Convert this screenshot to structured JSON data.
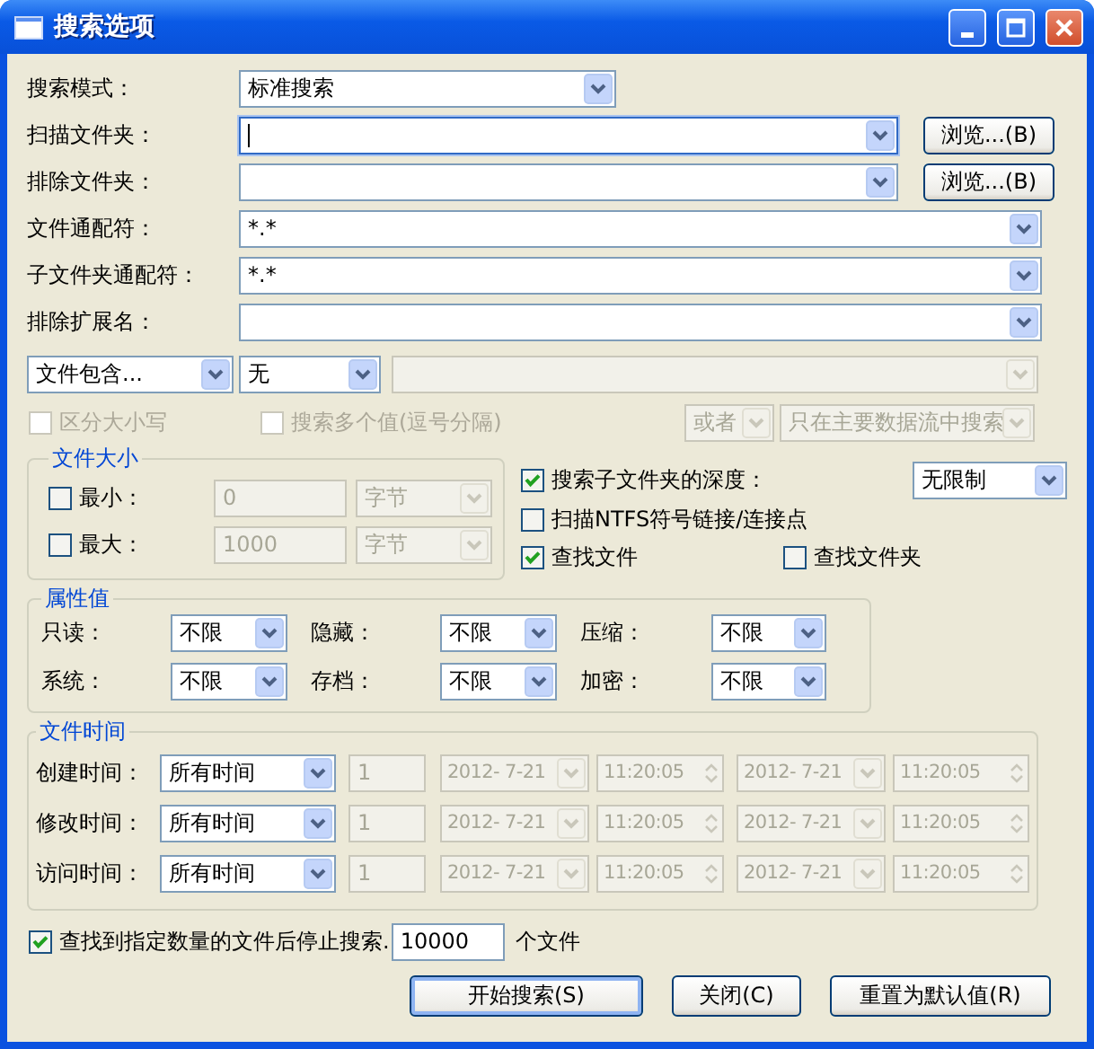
{
  "window": {
    "title": "搜索选项"
  },
  "fields": [
    {
      "label": "搜索模式：",
      "value": "标准搜索",
      "kind": "short",
      "focused": false
    },
    {
      "label": "扫描文件夹：",
      "kind": "browse",
      "focused": true,
      "button": "浏览...(B)"
    },
    {
      "label": "排除文件夹：",
      "kind": "browse",
      "focused": false,
      "button": "浏览...(B)"
    },
    {
      "label": "文件通配符：",
      "value": "*.*",
      "kind": "wide",
      "focused": false
    },
    {
      "label": "子文件夹通配符：",
      "value": "*.*",
      "kind": "wide",
      "focused": false
    },
    {
      "label": "排除扩展名：",
      "kind": "wide",
      "focused": false
    }
  ],
  "content_filter": {
    "mode": "文件包含...",
    "operator": "无",
    "text_field": {
      "disabled": true
    }
  },
  "content_options": [
    {
      "label": "区分大小写",
      "checked": false,
      "disabled": true
    },
    {
      "label": "搜索多个值(逗号分隔)",
      "checked": false,
      "disabled": true
    }
  ],
  "content_combos": [
    {
      "value": "或者",
      "disabled": true
    },
    {
      "value": "只在主要数据流中搜索",
      "disabled": true
    }
  ],
  "file_size": {
    "title": "文件大小",
    "rows": [
      {
        "label": "最小：",
        "checked": false,
        "value": "0",
        "unit": "字节"
      },
      {
        "label": "最大：",
        "checked": false,
        "value": "1000",
        "unit": "字节"
      }
    ]
  },
  "subfolders": {
    "depth": {
      "label": "搜索子文件夹的深度：",
      "checked": true,
      "value": "无限制"
    },
    "ntfs": {
      "label": "扫描NTFS符号链接/连接点",
      "checked": false
    },
    "find_files": {
      "label": "查找文件",
      "checked": true
    },
    "find_folders": {
      "label": "查找文件夹",
      "checked": false
    }
  },
  "attributes": {
    "title": "属性值",
    "items": [
      {
        "label": "只读：",
        "value": "不限"
      },
      {
        "label": "隐藏：",
        "value": "不限"
      },
      {
        "label": "压缩：",
        "value": "不限"
      },
      {
        "label": "系统：",
        "value": "不限"
      },
      {
        "label": "存档：",
        "value": "不限"
      },
      {
        "label": "加密：",
        "value": "不限"
      }
    ]
  },
  "file_time": {
    "title": "文件时间",
    "rows": [
      {
        "label": "创建时间：",
        "range": "所有时间",
        "count": "1",
        "from_date": "2012- 7-21",
        "from_time": "11:20:05",
        "to_date": "2012- 7-21",
        "to_time": "11:20:05",
        "disabled": true
      },
      {
        "label": "修改时间：",
        "range": "所有时间",
        "count": "1",
        "from_date": "2012- 7-21",
        "from_time": "11:20:05",
        "to_date": "2012- 7-21",
        "to_time": "11:20:05",
        "disabled": true
      },
      {
        "label": "访问时间：",
        "range": "所有时间",
        "count": "1",
        "from_date": "2012- 7-21",
        "from_time": "11:20:05",
        "to_date": "2012- 7-21",
        "to_time": "11:20:05",
        "disabled": true
      }
    ]
  },
  "stop_limit": {
    "label": "查找到指定数量的文件后停止搜索.",
    "checked": true,
    "value": "10000",
    "unit": "个文件"
  },
  "buttons": [
    {
      "label": "开始搜索(S)",
      "default": true
    },
    {
      "label": "关闭(C)",
      "default": false
    },
    {
      "label": "重置为默认值(R)",
      "default": false
    }
  ]
}
